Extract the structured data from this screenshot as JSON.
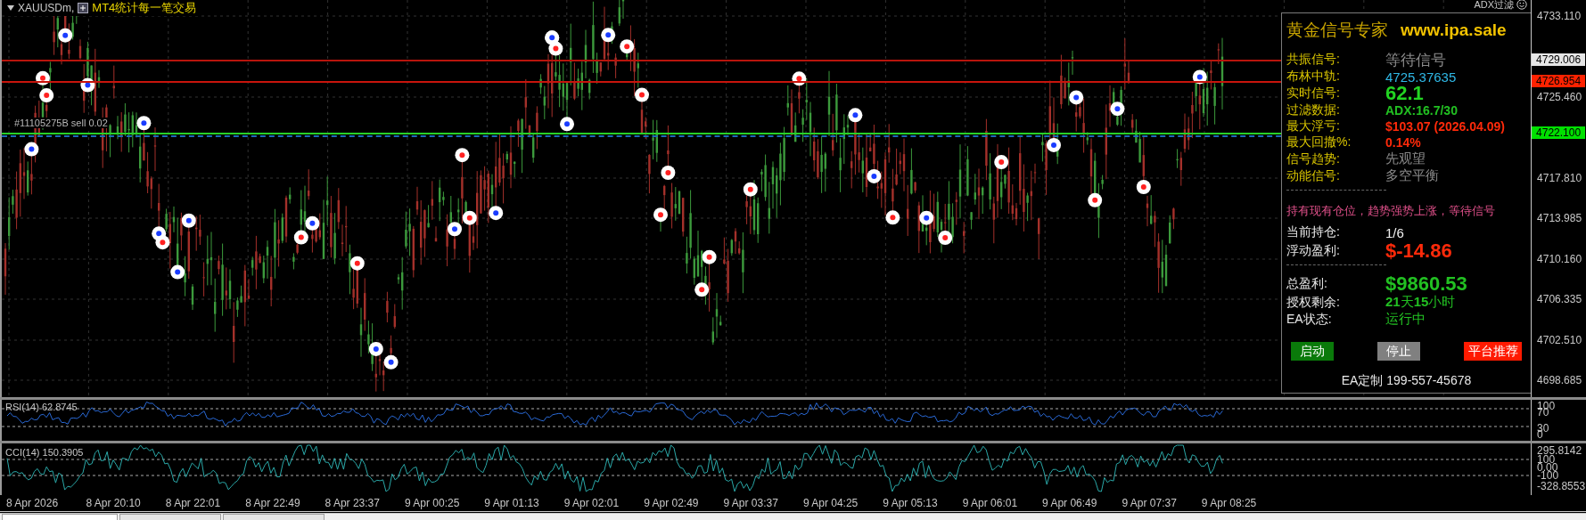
{
  "chart": {
    "symbol": "XAUUSDm,",
    "indicator": "MT4统计每一笔交易",
    "order_label": "#11105275B sell 0.02",
    "corner_label": "ADX过滤",
    "price_ticks": [
      "4733.110",
      "4725.460",
      "4717.810",
      "4713.985",
      "4710.160",
      "4706.335",
      "4702.510",
      "4698.685"
    ],
    "price_tags": [
      {
        "text": "4729.006",
        "color": "#e6e6e6"
      },
      {
        "text": "4726.954",
        "color": "#ff2200"
      },
      {
        "text": "4722.100",
        "color": "#00e000"
      }
    ]
  },
  "panel": {
    "title": "黄金信号专家",
    "site": "www.ipa.sale",
    "signals": [
      {
        "label": "共振信号:",
        "value": "等待信号",
        "color": "#8a8a8a",
        "kind": "large"
      },
      {
        "label": "布林中轨:",
        "value": "4725.37635",
        "color": "#2fb8e6",
        "kind": "normal"
      },
      {
        "label": "实时信号:",
        "value": "62.1",
        "color": "#22d422",
        "kind": "huge"
      },
      {
        "label": "过滤数据:",
        "value": "ADX:16.7/30",
        "color": "#22c022",
        "kind": "bold"
      },
      {
        "label": "最大浮亏:",
        "value": "$103.07 (2026.04.09)",
        "color": "#ff2a0a",
        "kind": "bold"
      },
      {
        "label": "最大回撤%:",
        "value": "0.14%",
        "color": "#ff2a0a",
        "kind": "bold"
      },
      {
        "label": "信号趋势:",
        "value": "先观望",
        "color": "#8a8a8a",
        "kind": "normal"
      },
      {
        "label": "动能信号:",
        "value": "多空平衡",
        "color": "#8a8a8a",
        "kind": "normal"
      }
    ],
    "message": "持有现有仓位，趋势强势上涨，等待信号",
    "position": [
      {
        "label": "当前持仓:",
        "value": "1/6",
        "color": "#f0f0f0",
        "kind": "normal"
      },
      {
        "label": "浮动盈利:",
        "value": "$-14.86",
        "color": "#ff2a0a",
        "kind": "huge"
      }
    ],
    "account": [
      {
        "label": "总盈利:",
        "value": "$9860.53",
        "color": "#22c022",
        "kind": "huge"
      },
      {
        "label": "授权剩余:",
        "value": "**21**天**15**小时",
        "color": "#22c022",
        "kind": "normal"
      },
      {
        "label": "EA状态:",
        "value": "运行中",
        "color": "#22c022",
        "kind": "normal"
      }
    ],
    "buttons": [
      {
        "label": "启动",
        "color": "#0a7a0a"
      },
      {
        "label": "停止",
        "color": "#808080"
      },
      {
        "label": "平台推荐",
        "color": "#ff1a00"
      }
    ],
    "contact": "EA定制 199-557-45678"
  },
  "rsi": {
    "label": "RSI(14) 62.8745",
    "ticks": [
      "100",
      "70",
      "30",
      "0"
    ]
  },
  "cci": {
    "label": "CCI(14) 150.3905",
    "ticks": [
      "295.8142",
      "100",
      "0.00",
      "-100",
      "-328.8553"
    ]
  },
  "time_axis": [
    "8 Apr 2026",
    "8 Apr 20:10",
    "8 Apr 22:01",
    "8 Apr 22:49",
    "8 Apr 23:37",
    "9 Apr 00:25",
    "9 Apr 01:13",
    "9 Apr 02:01",
    "9 Apr 02:49",
    "9 Apr 03:37",
    "9 Apr 04:25",
    "9 Apr 05:13",
    "9 Apr 06:01",
    "9 Apr 06:49",
    "9 Apr 07:37",
    "9 Apr 08:25"
  ],
  "tabs": [
    {
      "selected": true
    },
    {
      "selected": false
    },
    {
      "selected": false
    }
  ]
}
